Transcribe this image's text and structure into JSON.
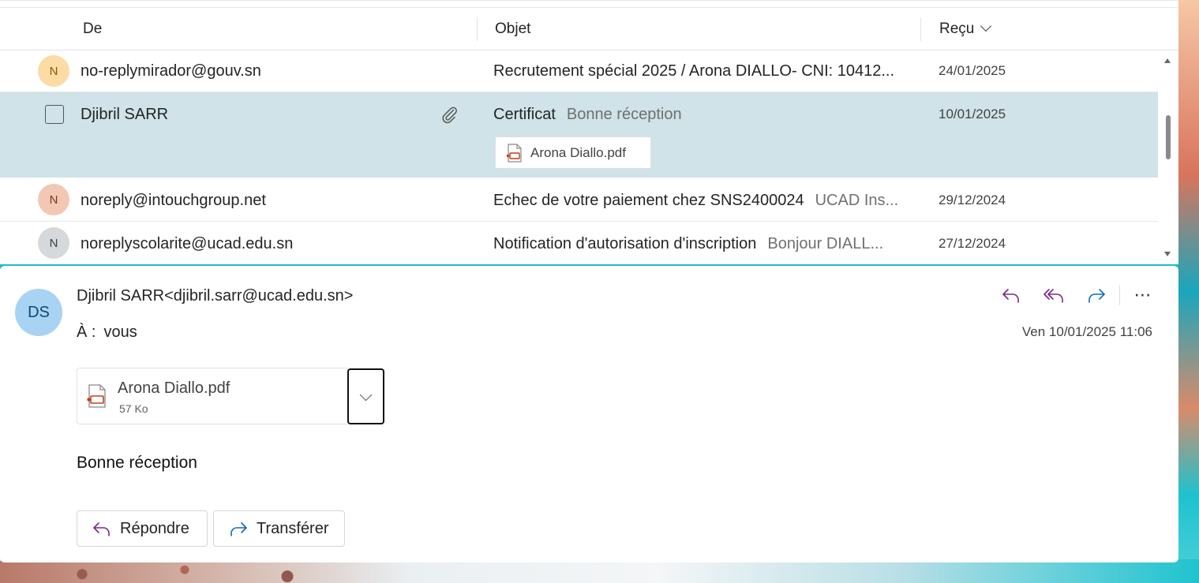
{
  "list": {
    "columns": {
      "from": "De",
      "subject": "Objet",
      "received": "Reçu"
    },
    "rows": [
      {
        "avatar": "N",
        "avatar_bg": "#fcdba5",
        "avatar_fg": "#8a5a00",
        "from": "no-replymirador@gouv.sn",
        "subject": "Recrutement spécial 2025 / Arona DIALLO- CNI: 10412...",
        "preview": "",
        "date": "24/01/2025"
      },
      {
        "from": "Djibril SARR",
        "subject": "Certificat",
        "preview": "Bonne réception",
        "date": "10/01/2025",
        "attachment": "Arona Diallo.pdf",
        "selected": true
      },
      {
        "avatar": "N",
        "avatar_bg": "#f2c8b4",
        "avatar_fg": "#7a3a20",
        "from": "noreply@intouchgroup.net",
        "subject": "Echec de votre paiement chez SNS2400024",
        "preview": "UCAD Ins...",
        "date": "29/12/2024"
      },
      {
        "avatar": "N",
        "avatar_bg": "#d6d9db",
        "avatar_fg": "#3d4245",
        "from": "noreplyscolarite@ucad.edu.sn",
        "subject": "Notification d'autorisation d'inscription",
        "preview": "Bonjour DIALL...",
        "date": "27/12/2024"
      }
    ]
  },
  "message": {
    "avatar_initials": "DS",
    "sender": "Djibril SARR<djibril.sarr@ucad.edu.sn>",
    "to_label": "À :",
    "to_value": "vous",
    "datetime": "Ven 10/01/2025 11:06",
    "attachment": {
      "name": "Arona Diallo.pdf",
      "size": "57 Ko"
    },
    "body": "Bonne réception",
    "buttons": {
      "reply": "Répondre",
      "forward": "Transférer"
    }
  },
  "icons": {
    "reply": "reply-icon",
    "reply_all": "reply-all-icon",
    "forward": "forward-icon",
    "more": "more-icon",
    "pdf": "pdf-file-icon",
    "paperclip": "paperclip-icon"
  },
  "colors": {
    "selected_row": "#cfe3e8",
    "reply_purple": "#7a2a83",
    "forward_blue": "#0f6cbd",
    "avatar_ds": "#a9d3f2"
  }
}
